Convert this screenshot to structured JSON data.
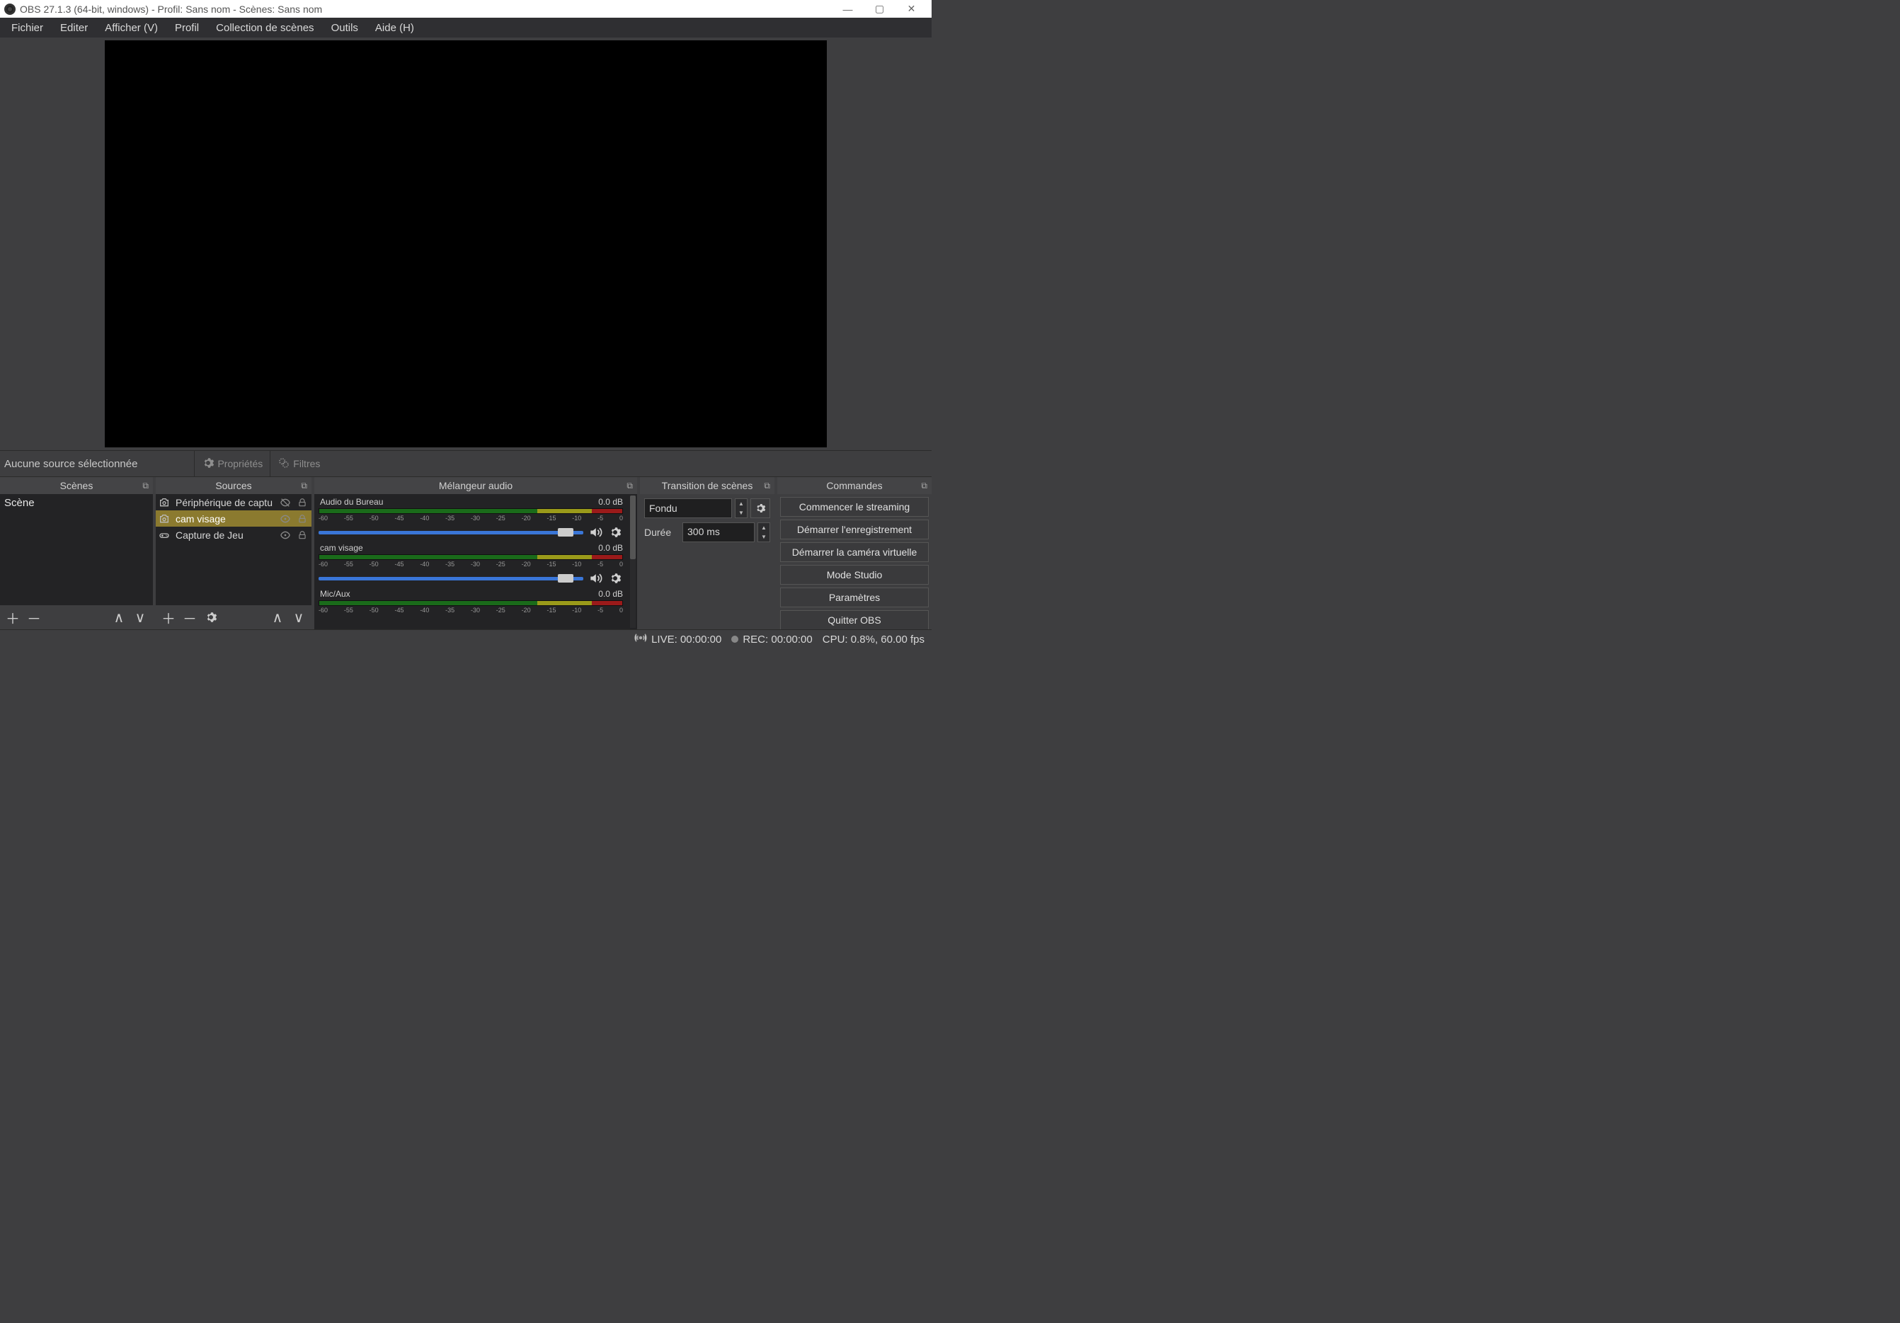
{
  "window": {
    "title": "OBS 27.1.3 (64-bit, windows) - Profil: Sans nom - Scènes: Sans nom"
  },
  "menu": {
    "file": "Fichier",
    "edit": "Editer",
    "view": "Afficher (V)",
    "profile": "Profil",
    "scenecol": "Collection de scènes",
    "tools": "Outils",
    "help": "Aide (H)"
  },
  "srcbar": {
    "none": "Aucune source sélectionnée",
    "props": "Propriétés",
    "filters": "Filtres"
  },
  "docks": {
    "scenes": {
      "title": "Scènes",
      "items": [
        "Scène"
      ]
    },
    "sources": {
      "title": "Sources",
      "items": [
        {
          "name": "Périphérique de captu",
          "icon": "camera",
          "selected": false,
          "hidden": true
        },
        {
          "name": "cam visage",
          "icon": "camera",
          "selected": true,
          "hidden": false
        },
        {
          "name": "Capture de Jeu",
          "icon": "gamepad",
          "selected": false,
          "hidden": false
        }
      ]
    },
    "mixer": {
      "title": "Mélangeur audio",
      "ticks": [
        "-60",
        "-55",
        "-50",
        "-45",
        "-40",
        "-35",
        "-30",
        "-25",
        "-20",
        "-15",
        "-10",
        "-5",
        "0"
      ],
      "channels": [
        {
          "name": "Audio du Bureau",
          "db": "0.0 dB"
        },
        {
          "name": "cam visage",
          "db": "0.0 dB"
        },
        {
          "name": "Mic/Aux",
          "db": "0.0 dB"
        }
      ]
    },
    "trans": {
      "title": "Transition de scènes",
      "value": "Fondu",
      "dur_label": "Durée",
      "dur_value": "300 ms"
    },
    "controls": {
      "title": "Commandes",
      "buttons": [
        "Commencer le streaming",
        "Démarrer l'enregistrement",
        "Démarrer la caméra virtuelle",
        "Mode Studio",
        "Paramètres",
        "Quitter OBS"
      ]
    }
  },
  "status": {
    "live": "LIVE: 00:00:00",
    "rec": "REC: 00:00:00",
    "cpu": "CPU: 0.8%, 60.00 fps"
  }
}
